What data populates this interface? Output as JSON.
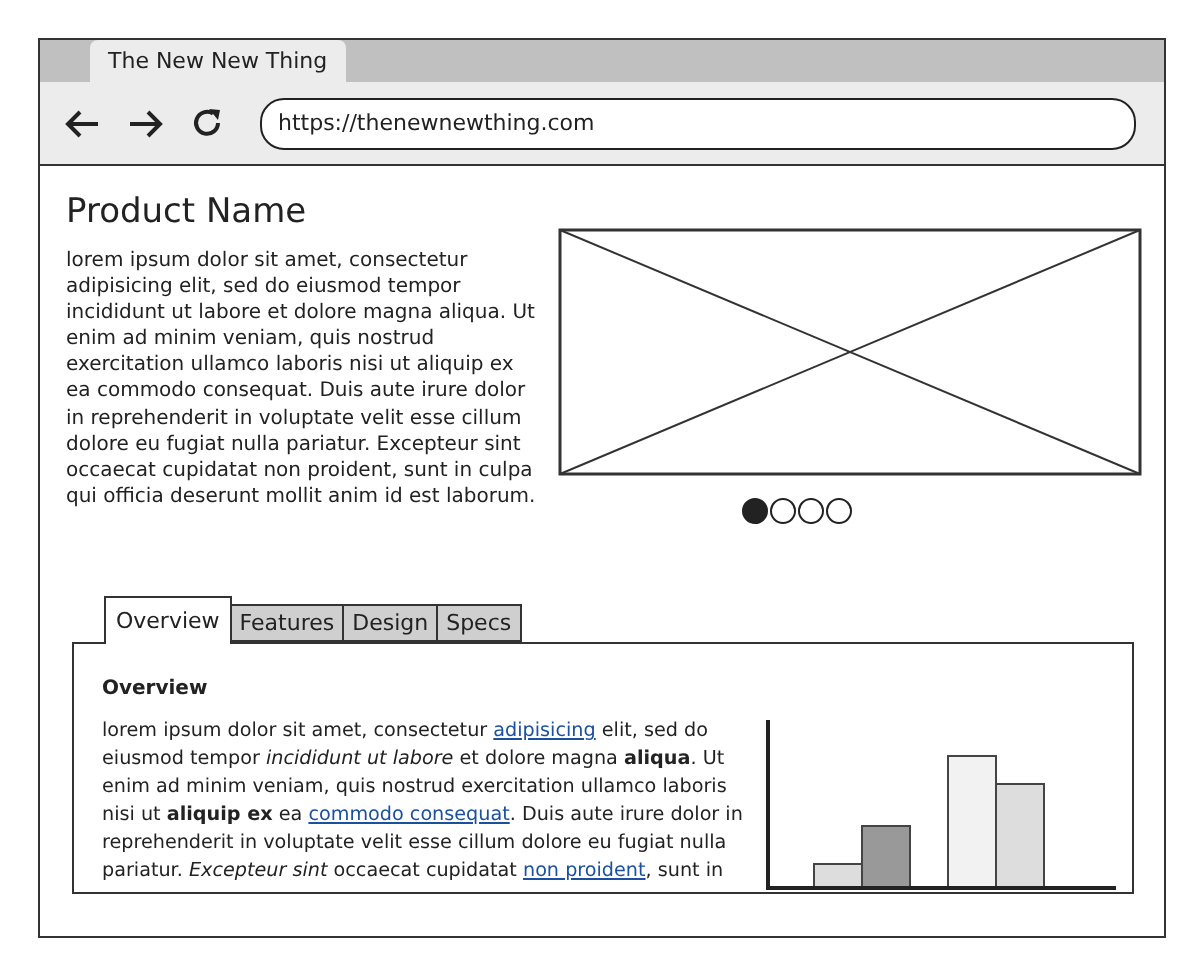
{
  "browser": {
    "tab_title": "The New New Thing",
    "url": "https://thenewnewthing.com"
  },
  "product": {
    "title": "Product Name",
    "description": "lorem ipsum dolor sit amet, consectetur adipisicing elit, sed do eiusmod tempor incididunt ut labore et dolore magna aliqua. Ut enim ad minim veniam, quis nostrud exercitation ullamco laboris nisi ut aliquip ex ea commodo consequat. Duis aute irure dolor in reprehenderit in voluptate velit esse cillum dolore eu fugiat nulla pariatur. Excepteur sint occaecat cupidatat non proident, sunt in culpa qui officia deserunt mollit anim id est laborum."
  },
  "carousel_dots": [
    {
      "selected": true
    },
    {
      "selected": false
    },
    {
      "selected": false
    },
    {
      "selected": false
    }
  ],
  "tabs": [
    {
      "label": "Overview",
      "selected": true
    },
    {
      "label": "Features",
      "selected": false
    },
    {
      "label": "Design",
      "selected": false
    },
    {
      "label": "Specs",
      "selected": false
    }
  ],
  "panel": {
    "heading": "Overview",
    "paragraph": [
      {
        "kind": "text",
        "text": "lorem ipsum dolor sit amet, consectetur "
      },
      {
        "kind": "link",
        "text": "adipisicing"
      },
      {
        "kind": "text",
        "text": " elit, sed do eiusmod tempor *incididunt ut labore* et dolore magna **aliqua**. Ut enim ad minim veniam, quis nostrud exercitation ullamco laboris nisi ut **aliquip ex** ea "
      },
      {
        "kind": "link",
        "text": "commodo consequat"
      },
      {
        "kind": "text",
        "text": ". Duis aute irure dolor in reprehenderit in voluptate velit esse cillum dolore eu fugiat nulla pariatur. *Excepteur sint* occaecat cupidatat "
      },
      {
        "kind": "link",
        "text": "non proident"
      },
      {
        "kind": "text",
        "text": ", sunt in"
      }
    ]
  }
}
